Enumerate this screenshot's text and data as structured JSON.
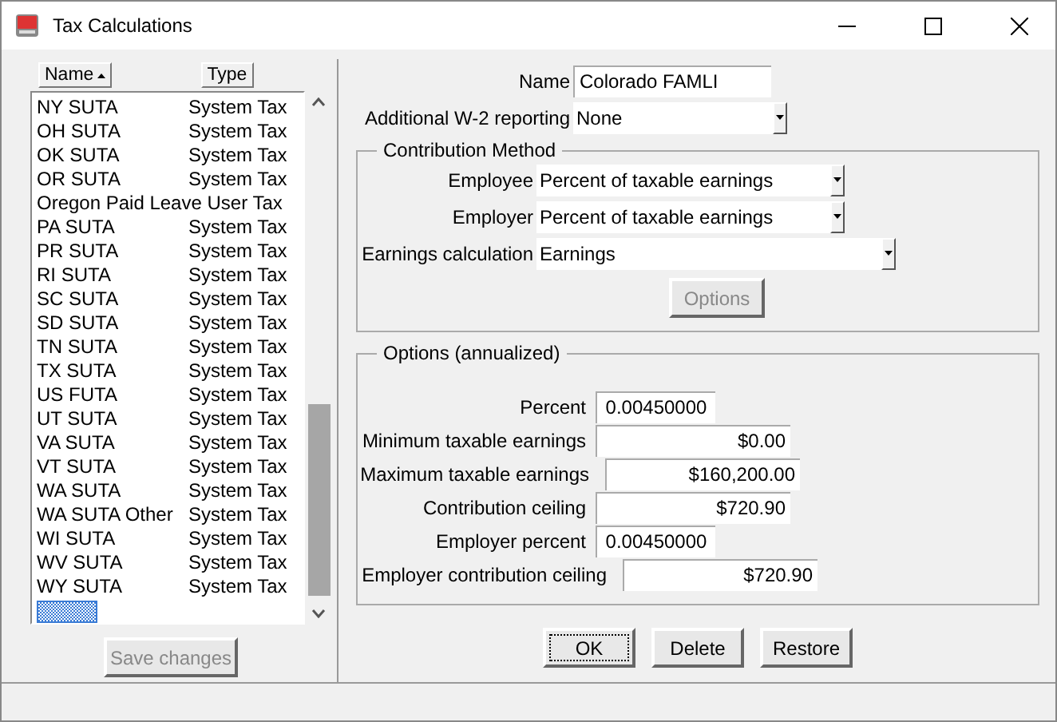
{
  "window": {
    "title": "Tax Calculations"
  },
  "list": {
    "columns": [
      {
        "label": "Name",
        "sorted": true
      },
      {
        "label": "Type",
        "sorted": false
      }
    ],
    "rows": [
      {
        "name": "NY SUTA",
        "type": "System Tax"
      },
      {
        "name": "OH SUTA",
        "type": "System Tax"
      },
      {
        "name": "OK SUTA",
        "type": "System Tax"
      },
      {
        "name": "OR SUTA",
        "type": "System Tax"
      },
      {
        "name": "Oregon Paid Leave User Tax"
      },
      {
        "name": "PA SUTA",
        "type": "System Tax"
      },
      {
        "name": "PR SUTA",
        "type": "System Tax"
      },
      {
        "name": "RI SUTA",
        "type": "System Tax"
      },
      {
        "name": "SC SUTA",
        "type": "System Tax"
      },
      {
        "name": "SD SUTA",
        "type": "System Tax"
      },
      {
        "name": "TN SUTA",
        "type": "System Tax"
      },
      {
        "name": "TX SUTA",
        "type": "System Tax"
      },
      {
        "name": "US FUTA",
        "type": "System Tax"
      },
      {
        "name": "UT SUTA",
        "type": "System Tax"
      },
      {
        "name": "VA SUTA",
        "type": "System Tax"
      },
      {
        "name": "VT SUTA",
        "type": "System Tax"
      },
      {
        "name": "WA SUTA",
        "type": "System Tax"
      },
      {
        "name": "WA SUTA Other",
        "type": "System Tax"
      },
      {
        "name": "WI SUTA",
        "type": "System Tax"
      },
      {
        "name": "WV SUTA",
        "type": "System Tax"
      },
      {
        "name": "WY SUTA",
        "type": "System Tax"
      }
    ],
    "new_entry": {
      "selected": true
    },
    "save_button": {
      "label": "Save changes",
      "disabled": true
    }
  },
  "form": {
    "name": {
      "label": "Name",
      "value": "Colorado FAMLI"
    },
    "w2": {
      "label": "Additional W-2 reporting",
      "value": "None"
    },
    "contribution": {
      "title": "Contribution Method",
      "fields": [
        {
          "label": "Employee",
          "value": "Percent of taxable earnings"
        },
        {
          "label": "Employer",
          "value": "Percent of taxable earnings"
        },
        {
          "label": "Earnings calculation",
          "value": "Earnings"
        }
      ],
      "options_button": {
        "label": "Options",
        "disabled": true
      }
    },
    "options": {
      "title": "Options (annualized)",
      "fields": [
        {
          "label": "Percent",
          "value": "0.00450000",
          "kind": "short"
        },
        {
          "label": "Minimum taxable earnings",
          "value": "$0.00",
          "kind": "long"
        },
        {
          "label": "Maximum taxable earnings",
          "value": "$160,200.00",
          "kind": "long"
        },
        {
          "label": "Contribution ceiling",
          "value": "$720.90",
          "kind": "long"
        },
        {
          "label": "Employer percent",
          "value": "0.00450000",
          "kind": "short"
        },
        {
          "label": "Employer contribution ceiling",
          "value": "$720.90",
          "kind": "long"
        }
      ]
    },
    "buttons": [
      {
        "label": "OK",
        "focused": true
      },
      {
        "label": "Delete",
        "focused": false
      },
      {
        "label": "Restore",
        "focused": false
      }
    ]
  }
}
